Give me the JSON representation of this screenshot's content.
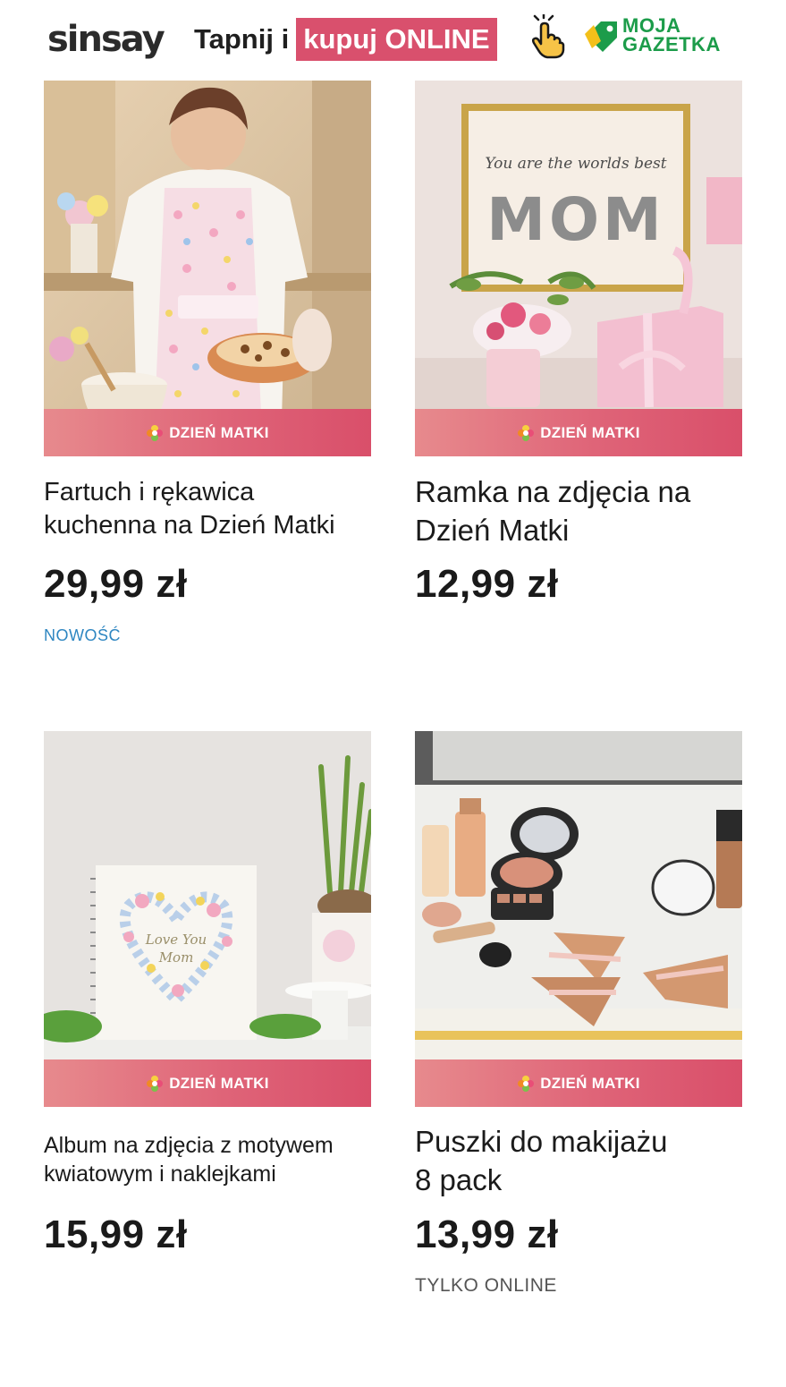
{
  "header": {
    "logo": "sinsay",
    "cta_text": "Tapnij i",
    "cta_highlight": "kupuj ONLINE",
    "partner_line1": "MOJA",
    "partner_line2": "GAZETKA"
  },
  "colors": {
    "accent": "#d9506d",
    "badge_gradient_start": "#e78a8d",
    "new_tag": "#2e86c1",
    "online_tag": "#555555",
    "partner_green": "#1c9c4a"
  },
  "products": [
    {
      "badge": "DZIEŃ MATKI",
      "title_line1": "Fartuch i rękawica",
      "title_line2": "kuchenna na Dzień Matki",
      "price": "29,99 zł",
      "tag": "NOWOŚĆ",
      "image_icon": "apron-photo"
    },
    {
      "badge": "DZIEŃ MATKI",
      "title_line1": "Ramka na zdjęcia na",
      "title_line2": "Dzień Matki",
      "price": "12,99 zł",
      "tag": "",
      "image_icon": "photo-frame-photo",
      "image_caption": "You are the worlds best",
      "image_word": "MOM"
    },
    {
      "badge": "DZIEŃ MATKI",
      "title_line1": "Album na zdjęcia z motywem",
      "title_line2": "kwiatowym i naklejkami",
      "price": "15,99 zł",
      "tag": "",
      "image_icon": "photo-album-photo",
      "image_caption_line1": "Love You",
      "image_caption_line2": "Mom"
    },
    {
      "badge": "DZIEŃ MATKI",
      "title_line1": "Puszki do makijażu",
      "title_line2": "8 pack",
      "price": "13,99 zł",
      "tag": "TYLKO ONLINE",
      "image_icon": "makeup-puffs-photo"
    }
  ]
}
